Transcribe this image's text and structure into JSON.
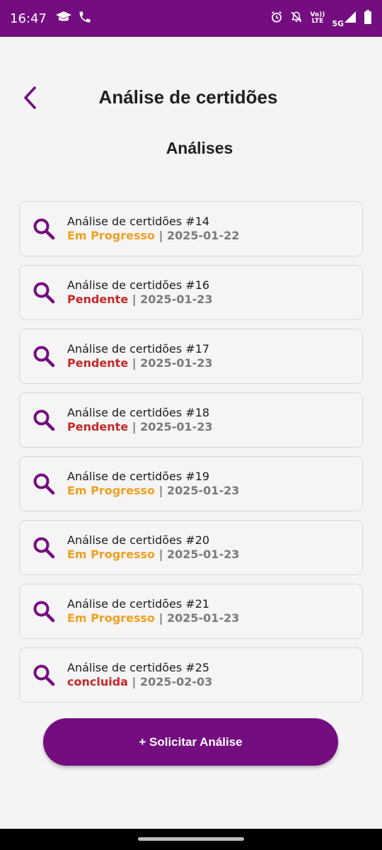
{
  "status_bar": {
    "time": "16:47",
    "volte_line1": "Vo))",
    "volte_line2": "LTE",
    "network": "5G",
    "icons": [
      "graduation-cap-icon",
      "phone-icon",
      "alarm-icon",
      "bell-off-icon",
      "signal-icon",
      "battery-icon"
    ]
  },
  "header": {
    "back_icon": "chevron-left-icon",
    "title": "Análise de certidões"
  },
  "section_title": "Análises",
  "colors": {
    "brand": "#740d80",
    "status_in_progress": "#f0a020",
    "status_pending": "#c62828",
    "status_done": "#c62828",
    "date": "#7a7a7a"
  },
  "items": [
    {
      "title": "Análise de certidões #14",
      "status": "Em Progresso",
      "status_type": "in_progress",
      "separator": " | ",
      "date": "2025-01-22",
      "icon": "search-icon"
    },
    {
      "title": "Análise de certidões #16",
      "status": "Pendente",
      "status_type": "pending",
      "separator": " | ",
      "date": "2025-01-23",
      "icon": "search-icon"
    },
    {
      "title": "Análise de certidões #17",
      "status": "Pendente",
      "status_type": "pending",
      "separator": " | ",
      "date": "2025-01-23",
      "icon": "search-icon"
    },
    {
      "title": "Análise de certidões #18",
      "status": "Pendente",
      "status_type": "pending",
      "separator": " | ",
      "date": "2025-01-23",
      "icon": "search-icon"
    },
    {
      "title": "Análise de certidões #19",
      "status": "Em Progresso",
      "status_type": "in_progress",
      "separator": " | ",
      "date": "2025-01-23",
      "icon": "search-icon"
    },
    {
      "title": "Análise de certidões #20",
      "status": "Em Progresso",
      "status_type": "in_progress",
      "separator": " | ",
      "date": "2025-01-23",
      "icon": "search-icon"
    },
    {
      "title": "Análise de certidões #21",
      "status": "Em Progresso",
      "status_type": "in_progress",
      "separator": " | ",
      "date": "2025-01-23",
      "icon": "search-icon"
    },
    {
      "title": "Análise de certidões #25",
      "status": "concluida",
      "status_type": "done",
      "separator": " | ",
      "date": "2025-02-03",
      "icon": "search-icon"
    }
  ],
  "primary_button": {
    "label": "+ Solicitar Análise"
  }
}
